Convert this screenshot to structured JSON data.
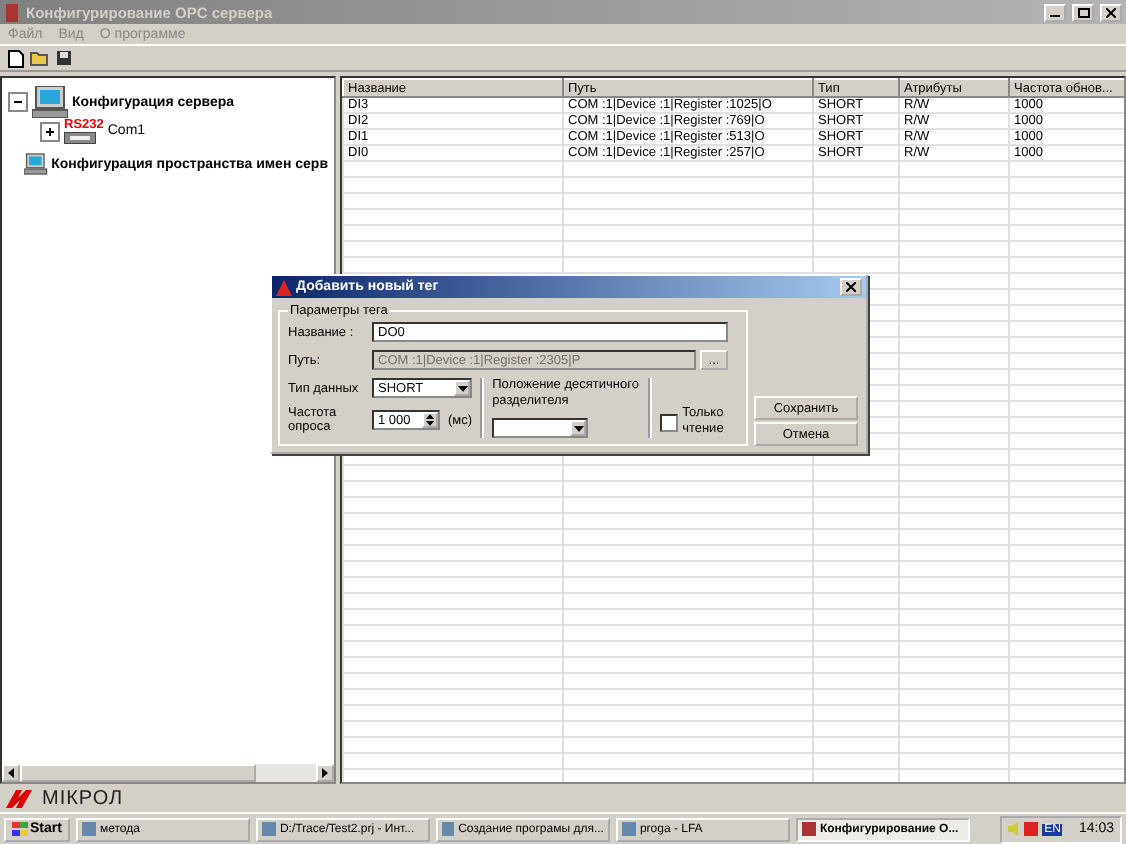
{
  "window": {
    "title": "Конфигурирование OPC сервера"
  },
  "menu": [
    "Файл",
    "Вид",
    "О программе"
  ],
  "tree": [
    {
      "label": "Конфигурация сервера",
      "expanded": true,
      "children": [
        {
          "label": "Com1",
          "badge": "RS232",
          "expanded": false
        }
      ]
    },
    {
      "label": "Конфигурация пространства имен серв"
    }
  ],
  "table": {
    "columns": [
      "Название",
      "Путь",
      "Тип",
      "Атрибуты",
      "Частота обнов..."
    ],
    "rows": [
      [
        "DI3",
        "COM :1|Device :1|Register :1025|O",
        "SHORT",
        "R/W",
        "1000"
      ],
      [
        "DI2",
        "COM :1|Device :1|Register :769|O",
        "SHORT",
        "R/W",
        "1000"
      ],
      [
        "DI1",
        "COM :1|Device :1|Register :513|O",
        "SHORT",
        "R/W",
        "1000"
      ],
      [
        "DI0",
        "COM :1|Device :1|Register :257|O",
        "SHORT",
        "R/W",
        "1000"
      ]
    ]
  },
  "dialog": {
    "title": "Добавить новый тег",
    "group": "Параметры тега",
    "name": {
      "label": "Название :",
      "value": "DO0"
    },
    "path": {
      "label": "Путь:",
      "value": "COM :1|Device :1|Register :2305|P",
      "disabled": true,
      "browse": "..."
    },
    "data_type": {
      "label": "Тип данных",
      "value": "SHORT"
    },
    "poll_rate": {
      "label": "Частота опроса",
      "value": "1 000",
      "unit": "(мс)"
    },
    "decimal": {
      "label": "Положение десятичного разделителя"
    },
    "read_only": {
      "label": "Только чтение",
      "checked": false
    },
    "buttons": [
      "Сохранить",
      "Отмена"
    ]
  },
  "logo": "МІКРОЛ",
  "taskbar": {
    "start": "Start",
    "items": [
      {
        "label": "метода",
        "selected": false
      },
      {
        "label": "D:/Trace/Test2.prj - Инт...",
        "selected": false
      },
      {
        "label": "Создание програмы для...",
        "selected": false
      },
      {
        "label": "proga - LFA",
        "selected": false
      },
      {
        "label": "Конфигурирование О...",
        "selected": true
      }
    ],
    "language": "EN",
    "clock": "14:03"
  }
}
